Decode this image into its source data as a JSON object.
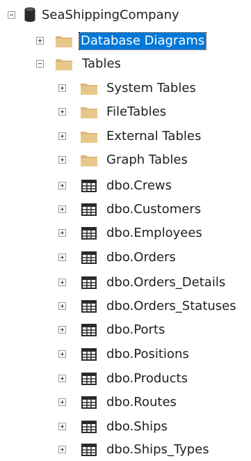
{
  "tree": {
    "root": {
      "label": "SeaShippingCompany",
      "icon": "database-icon",
      "expanded": true
    },
    "database_diagrams": {
      "label": "Database Diagrams",
      "icon": "folder-icon",
      "expanded": false,
      "selected": true
    },
    "tables": {
      "label": "Tables",
      "icon": "folder-icon",
      "expanded": true
    },
    "table_folders": [
      {
        "label": "System Tables",
        "icon": "folder-icon"
      },
      {
        "label": "FileTables",
        "icon": "folder-icon"
      },
      {
        "label": "External Tables",
        "icon": "folder-icon"
      },
      {
        "label": "Graph Tables",
        "icon": "folder-icon"
      }
    ],
    "table_items": [
      {
        "label": "dbo.Crews",
        "icon": "table-icon"
      },
      {
        "label": "dbo.Customers",
        "icon": "table-icon"
      },
      {
        "label": "dbo.Employees",
        "icon": "table-icon"
      },
      {
        "label": "dbo.Orders",
        "icon": "table-icon"
      },
      {
        "label": "dbo.Orders_Details",
        "icon": "table-icon"
      },
      {
        "label": "dbo.Orders_Statuses",
        "icon": "table-icon"
      },
      {
        "label": "dbo.Ports",
        "icon": "table-icon"
      },
      {
        "label": "dbo.Positions",
        "icon": "table-icon"
      },
      {
        "label": "dbo.Products",
        "icon": "table-icon"
      },
      {
        "label": "dbo.Routes",
        "icon": "table-icon"
      },
      {
        "label": "dbo.Ships",
        "icon": "table-icon"
      },
      {
        "label": "dbo.Ships_Types",
        "icon": "table-icon"
      }
    ]
  },
  "colors": {
    "folder": "#dcb67a",
    "selection": "#0078d7",
    "database": "#2b2b2b"
  }
}
